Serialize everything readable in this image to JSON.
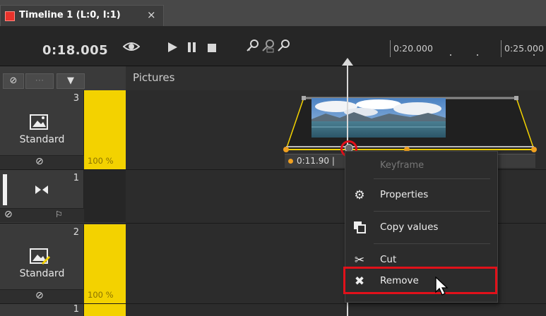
{
  "tab": {
    "title": "Timeline 1 (L:0, I:1)",
    "close": "×"
  },
  "toolbar": {
    "time": "0:18.005"
  },
  "ruler": {
    "labels": [
      "0:20.000",
      "0:25.000"
    ]
  },
  "section": {
    "title": "Pictures"
  },
  "tracks": [
    {
      "number": "3",
      "label": "Standard",
      "opacity": "100 %"
    },
    {
      "number": "1"
    },
    {
      "number": "2",
      "label": "Standard",
      "opacity": "100 %"
    },
    {
      "number": "1"
    }
  ],
  "clip": {
    "time": "0:11.90 |"
  },
  "context_menu": {
    "header": "Keyframe",
    "items": [
      {
        "label": "Properties",
        "icon": "gear-icon"
      },
      {
        "label": "Copy values",
        "icon": "copy-icon"
      },
      {
        "label": "Cut",
        "icon": "scissors-icon"
      },
      {
        "label": "Remove",
        "icon": "x-icon"
      }
    ]
  },
  "colors": {
    "accent_yellow": "#f3d200",
    "highlight_red": "#e1111a",
    "tab_red": "#e8322b"
  }
}
